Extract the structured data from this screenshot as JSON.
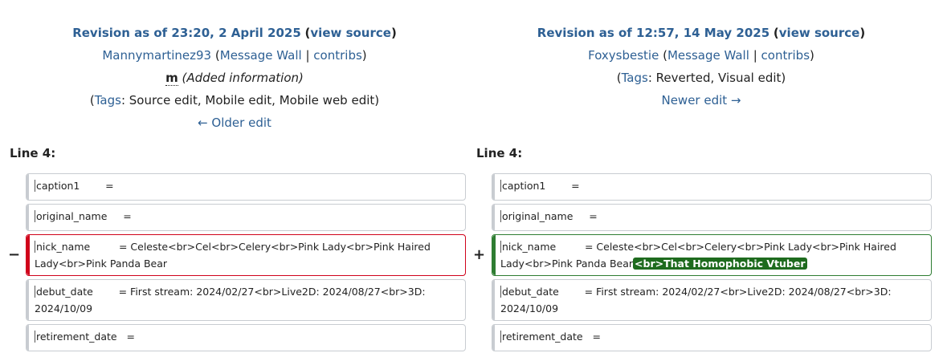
{
  "left": {
    "title_prefix": "Revision as of 23:20, 2 April 2025",
    "view_source": "view source",
    "user": "Mannymartinez93",
    "message_wall": "Message Wall",
    "contribs": "contribs",
    "minor_flag": "m",
    "summary": "(Added information)",
    "tags_label": "Tags",
    "tags_values": ": Source edit, Mobile edit, Mobile web edit)",
    "nav": "← Older edit",
    "line_label": "Line 4:"
  },
  "right": {
    "title_prefix": "Revision as of 12:57, 14 May 2025",
    "view_source": "view source",
    "user": "Foxysbestie",
    "message_wall": "Message Wall",
    "contribs": "contribs",
    "tags_label": "Tags",
    "tags_values": ": Reverted, Visual edit)",
    "nav": "Newer edit →",
    "line_label": "Line 4:"
  },
  "diff": {
    "minus_marker": "−",
    "plus_marker": "+",
    "caption1": "caption1        =",
    "original_name": "original_name     =",
    "nick_name_old": "nick_name         = Celeste<br>Cel<br>Celery<br>Pink Lady<br>Pink Haired Lady<br>Pink Panda Bear",
    "nick_name_new_base": "nick_name         = Celeste<br>Cel<br>Celery<br>Pink Lady<br>Pink Haired Lady<br>Pink Panda Bear",
    "nick_name_new_insert": "<br>That Homophobic Vtuber",
    "debut_date": "debut_date        = First stream: 2024/02/27<br>Live2D: 2024/08/27<br>3D: 2024/10/09",
    "retirement_date": "retirement_date   ="
  },
  "colors": {
    "link": "#2e6094",
    "removed_border": "#d0021b",
    "added_border": "#2e7d32",
    "added_highlight": "#1e6b1e"
  }
}
